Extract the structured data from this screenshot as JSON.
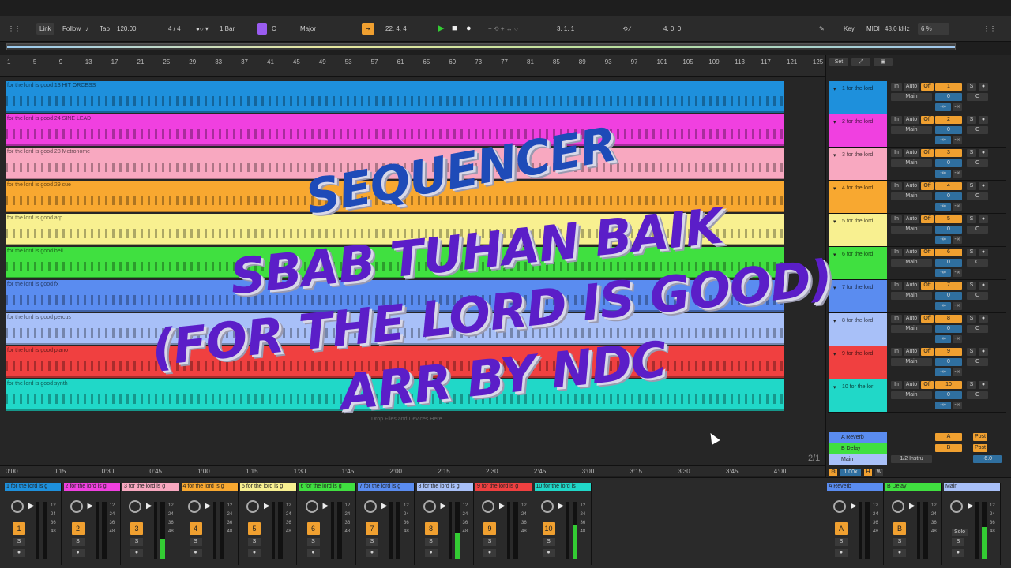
{
  "topbar": {
    "link": "Link",
    "follow": "Follow",
    "tap": "Tap",
    "tempo": "120.00",
    "signature": "4 / 4",
    "quant": "1 Bar",
    "key": "C",
    "scale": "Major",
    "position": "22.  4.  4",
    "loop_start": "3.  1.  1",
    "loop_length": "4.  0.  0",
    "key_label": "Key",
    "midi_label": "MIDI",
    "sample_rate": "48.0 kHz",
    "cpu": "6 %"
  },
  "ruler": {
    "marks": [
      "1",
      "5",
      "9",
      "13",
      "17",
      "21",
      "25",
      "29",
      "33",
      "37",
      "41",
      "45",
      "49",
      "53",
      "57",
      "61",
      "65",
      "69",
      "73",
      "77",
      "81",
      "85",
      "89",
      "93",
      "97",
      "101",
      "105",
      "109",
      "113",
      "117",
      "121",
      "125"
    ]
  },
  "time_ruler": {
    "marks": [
      "0:00",
      "0:15",
      "0:30",
      "0:45",
      "1:00",
      "1:15",
      "1:30",
      "1:45",
      "2:00",
      "2:15",
      "2:30",
      "2:45",
      "3:00",
      "3:15",
      "3:30",
      "3:45",
      "4:00"
    ]
  },
  "tracks": [
    {
      "clip": "for the lord is good 13 HIT ORCESS",
      "head": "1 for the lord",
      "num": "1",
      "color": "#1e90dc"
    },
    {
      "clip": "for the lord is good 24 SINE LEAD",
      "head": "2 for the lord",
      "num": "2",
      "color": "#f040e0"
    },
    {
      "clip": "for the lord is good 28 Metronome",
      "head": "3 for the lord",
      "num": "3",
      "color": "#f8a8c0"
    },
    {
      "clip": "for the lord is good 29 cue",
      "head": "4 for the lord",
      "num": "4",
      "color": "#f8a830"
    },
    {
      "clip": "for the lord is good arp",
      "head": "5 for the lord",
      "num": "5",
      "color": "#f8f090"
    },
    {
      "clip": "for the lord is good bell",
      "head": "6 for the lord",
      "num": "6",
      "color": "#40e040"
    },
    {
      "clip": "for the lord is good fx",
      "head": "7 for the lord",
      "num": "7",
      "color": "#5a8cf0"
    },
    {
      "clip": "for the lord is good percus",
      "head": "8 for the lord",
      "num": "8",
      "color": "#a8c0f8"
    },
    {
      "clip": "for the lord is good piano",
      "head": "9 for the lord",
      "num": "9",
      "color": "#f04040"
    },
    {
      "clip": "for the lord is good synth",
      "head": "10 for the lor",
      "num": "10",
      "color": "#20d8c8"
    }
  ],
  "track_controls": {
    "in": "In",
    "auto": "Auto",
    "off": "Off",
    "s": "S",
    "main": "Main",
    "c": "C",
    "inf": "-∞",
    "zero": "0"
  },
  "drop_hint": "Drop Files and Devices Here",
  "page_counter": "2/1",
  "set_label": "Set",
  "returns": [
    {
      "name": "A Reverb",
      "letter": "A",
      "post": "Post",
      "color": "#5a8cf0"
    },
    {
      "name": "B Delay",
      "letter": "B",
      "post": "Post",
      "color": "#40e040"
    },
    {
      "name": "Main",
      "letter": "",
      "post": "",
      "color": "#a8c0f8"
    }
  ],
  "main_input": "1/2 Instru",
  "main_val": "-6.0",
  "zoom": "1.00x",
  "hw": "H",
  "w": "W",
  "mixer": {
    "strips": [
      {
        "name": "1 for the lord is g",
        "num": "1",
        "color": "#1e90dc",
        "level": 0
      },
      {
        "name": "2 for the lord is g",
        "num": "2",
        "color": "#f040e0",
        "level": 0
      },
      {
        "name": "3 for the lord is g",
        "num": "3",
        "color": "#f8a8c0",
        "level": 0.35
      },
      {
        "name": "4 for the lord is g",
        "num": "4",
        "color": "#f8a830",
        "level": 0
      },
      {
        "name": "5 for the lord is g",
        "num": "5",
        "color": "#f8f090",
        "level": 0
      },
      {
        "name": "6 for the lord is g",
        "num": "6",
        "color": "#40e040",
        "level": 0
      },
      {
        "name": "7 for the lord is g",
        "num": "7",
        "color": "#5a8cf0",
        "level": 0
      },
      {
        "name": "8 for the lord is g",
        "num": "8",
        "color": "#a8c0f8",
        "level": 0.45
      },
      {
        "name": "9 for the lord is g",
        "num": "9",
        "color": "#f04040",
        "level": 0
      },
      {
        "name": "10 for the lord is",
        "num": "10",
        "color": "#20d8c8",
        "level": 0.6
      }
    ],
    "returns": [
      {
        "name": "A Reverb",
        "num": "A",
        "color": "#5a8cf0",
        "level": 0
      },
      {
        "name": "B Delay",
        "num": "B",
        "color": "#40e040",
        "level": 0
      },
      {
        "name": "Main",
        "num": "",
        "color": "#a8c0f8",
        "level": 0.55
      }
    ],
    "db": [
      "12",
      "24",
      "36",
      "48"
    ],
    "solo_label": "Solo"
  },
  "overlay": {
    "line1": "SEQUENCER",
    "line2": "SBAB TUHAN BAIK",
    "line3": "(FOR THE LORD IS GOOD)",
    "line4": "ARR BY NDC"
  }
}
